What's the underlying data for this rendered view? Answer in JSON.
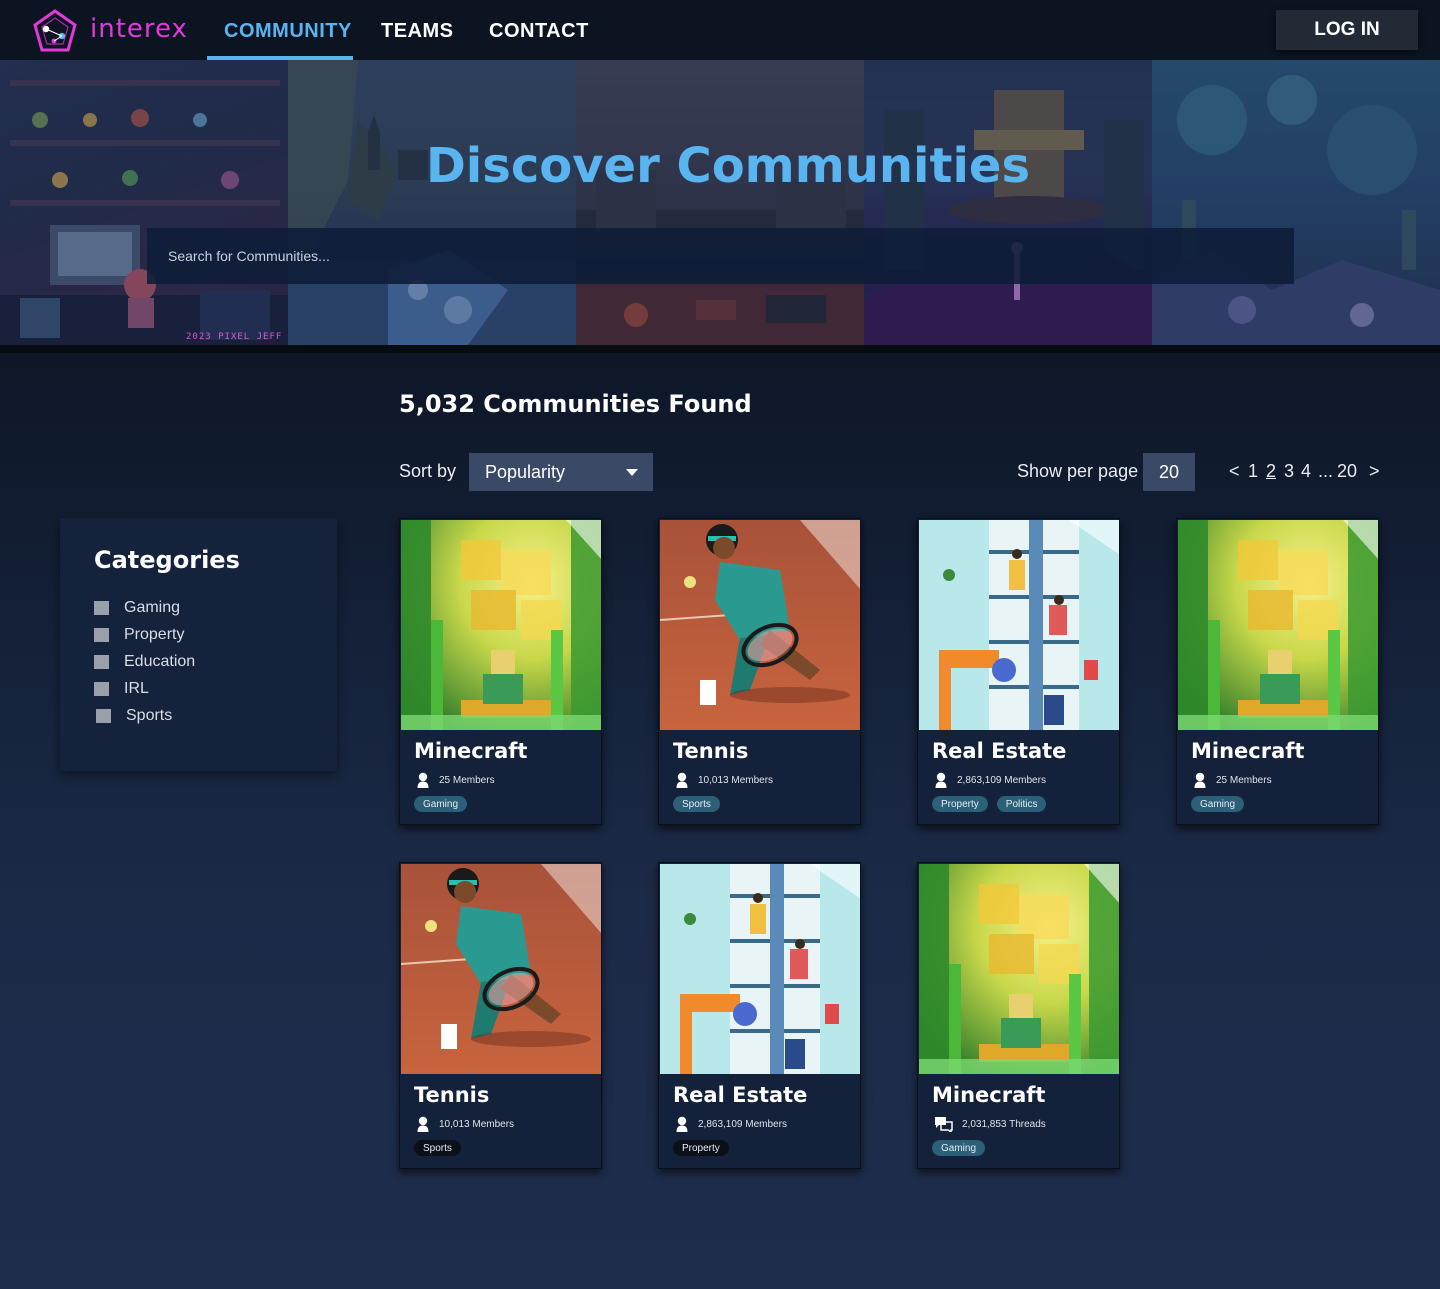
{
  "nav": {
    "brand": "interex",
    "items": [
      {
        "label": "COMMUNITY",
        "active": true
      },
      {
        "label": "TEAMS",
        "active": false
      },
      {
        "label": "CONTACT",
        "active": false
      }
    ],
    "login_label": "LOG IN"
  },
  "hero": {
    "title": "Discover Communities",
    "search_placeholder": "Search for Communities...",
    "credit": "2023 PIXEL JEFF"
  },
  "results": {
    "count_label": "5,032 Communities Found",
    "sort_label": "Sort by",
    "sort_value": "Popularity",
    "per_page_label": "Show per page",
    "per_page_value": "20",
    "pagination": {
      "prev": "<",
      "pages": [
        "1",
        "2",
        "3",
        "4"
      ],
      "current": "2",
      "ellipsis": "...",
      "last": "20",
      "next": ">"
    }
  },
  "categories": {
    "title": "Categories",
    "items": [
      "Gaming",
      "Property",
      "Education",
      "IRL",
      "Sports"
    ]
  },
  "cards": [
    {
      "title": "Minecraft",
      "stat": "25 Members",
      "stat_icon": "member-icon",
      "image": "minecraft",
      "tags": [
        {
          "label": "Gaming",
          "style": "teal"
        }
      ]
    },
    {
      "title": "Tennis",
      "stat": "10,013 Members",
      "stat_icon": "member-icon",
      "image": "tennis",
      "tags": [
        {
          "label": "Sports",
          "style": "teal"
        }
      ]
    },
    {
      "title": "Real Estate",
      "stat": "2,863,109 Members",
      "stat_icon": "member-icon",
      "image": "real-estate",
      "tags": [
        {
          "label": "Property",
          "style": "teal"
        },
        {
          "label": "Politics",
          "style": "teal"
        }
      ]
    },
    {
      "title": "Minecraft",
      "stat": "25 Members",
      "stat_icon": "member-icon",
      "image": "minecraft",
      "tags": [
        {
          "label": "Gaming",
          "style": "teal"
        }
      ]
    },
    {
      "title": "Tennis",
      "stat": "10,013 Members",
      "stat_icon": "member-icon",
      "image": "tennis",
      "tags": [
        {
          "label": "Sports",
          "style": "dark"
        }
      ]
    },
    {
      "title": "Real Estate",
      "stat": "2,863,109 Members",
      "stat_icon": "member-icon",
      "image": "real-estate",
      "tags": [
        {
          "label": "Property",
          "style": "dark"
        }
      ]
    },
    {
      "title": "Minecraft",
      "stat": "2,031,853 Threads",
      "stat_icon": "threads-icon",
      "image": "minecraft",
      "tags": [
        {
          "label": "Gaming",
          "style": "teal"
        }
      ]
    }
  ],
  "colors": {
    "accent": "#5ab4ef",
    "brand": "#e23ad9",
    "tag_teal": "#2c5f78",
    "tag_dark": "#0b0f18"
  }
}
